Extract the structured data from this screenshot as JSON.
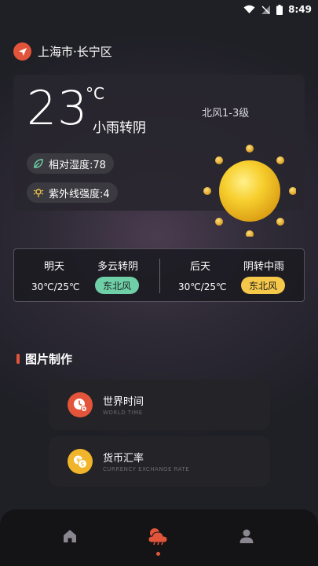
{
  "status_bar": {
    "time": "8:49"
  },
  "location": {
    "name": "上海市·长宁区"
  },
  "current": {
    "temperature": "23",
    "unit": "°C",
    "condition": "小雨转阴",
    "wind": "北风1-3级",
    "humidity": "相对湿度:78",
    "uv": "紫外线强度:4"
  },
  "forecast": [
    {
      "day": "明天",
      "condition": "多云转阴",
      "temp": "30℃/25℃",
      "wind": "东北风",
      "badge_color": "#6fd0a8"
    },
    {
      "day": "后天",
      "condition": "阴转中雨",
      "temp": "30℃/25℃",
      "wind": "东北风",
      "badge_color": "#f5c84a"
    }
  ],
  "section": {
    "title": "图片制作"
  },
  "tools": [
    {
      "title": "世界时间",
      "subtitle": "WORLD TIME",
      "icon": "clock-icon",
      "color": "#e2553a"
    },
    {
      "title": "货币汇率",
      "subtitle": "CURRENCY EXCHANGE RATE",
      "icon": "coins-icon",
      "color": "#f0b52a"
    }
  ],
  "nav": {
    "items": [
      "home-icon",
      "weather-icon",
      "profile-icon"
    ],
    "active": "weather-icon",
    "accent": "#e2553a"
  }
}
